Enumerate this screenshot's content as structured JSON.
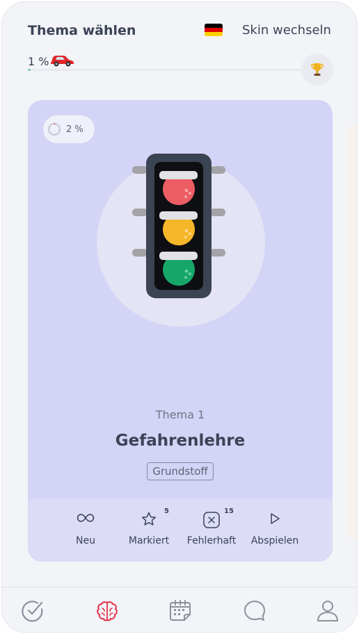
{
  "header": {
    "title": "Thema wählen",
    "skin_button": "Skin wechseln",
    "flag_icon": "germany-flag-icon",
    "flag_colors": [
      "#000000",
      "#dd0000",
      "#ffce00"
    ]
  },
  "progress": {
    "label": "1 %",
    "value_percent": 1,
    "car_icon": "red-car-icon",
    "trophy_icon": "trophy-icon"
  },
  "card": {
    "completion": "2 %",
    "completion_value": 2,
    "illustration": "traffic-light-icon",
    "topic_number": "Thema 1",
    "topic_name": "Gefahrenlehre",
    "badge": "Grundstoff",
    "background_color": "#d4d4f6",
    "actions": [
      {
        "label": "Neu",
        "icon": "infinity-icon",
        "count": ""
      },
      {
        "label": "Markiert",
        "icon": "star-icon",
        "count": "5"
      },
      {
        "label": "Fehlerhaft",
        "icon": "x-box-icon",
        "count": "15"
      },
      {
        "label": "Abspielen",
        "icon": "play-icon",
        "count": ""
      }
    ]
  },
  "nav": {
    "items": [
      {
        "icon": "check-circle-icon",
        "active": false
      },
      {
        "icon": "brain-icon",
        "active": true
      },
      {
        "icon": "calendar-icon",
        "active": false
      },
      {
        "icon": "chat-icon",
        "active": false
      },
      {
        "icon": "user-icon",
        "active": false
      }
    ],
    "active_color": "#e3344a",
    "inactive_color": "#8c909b"
  }
}
